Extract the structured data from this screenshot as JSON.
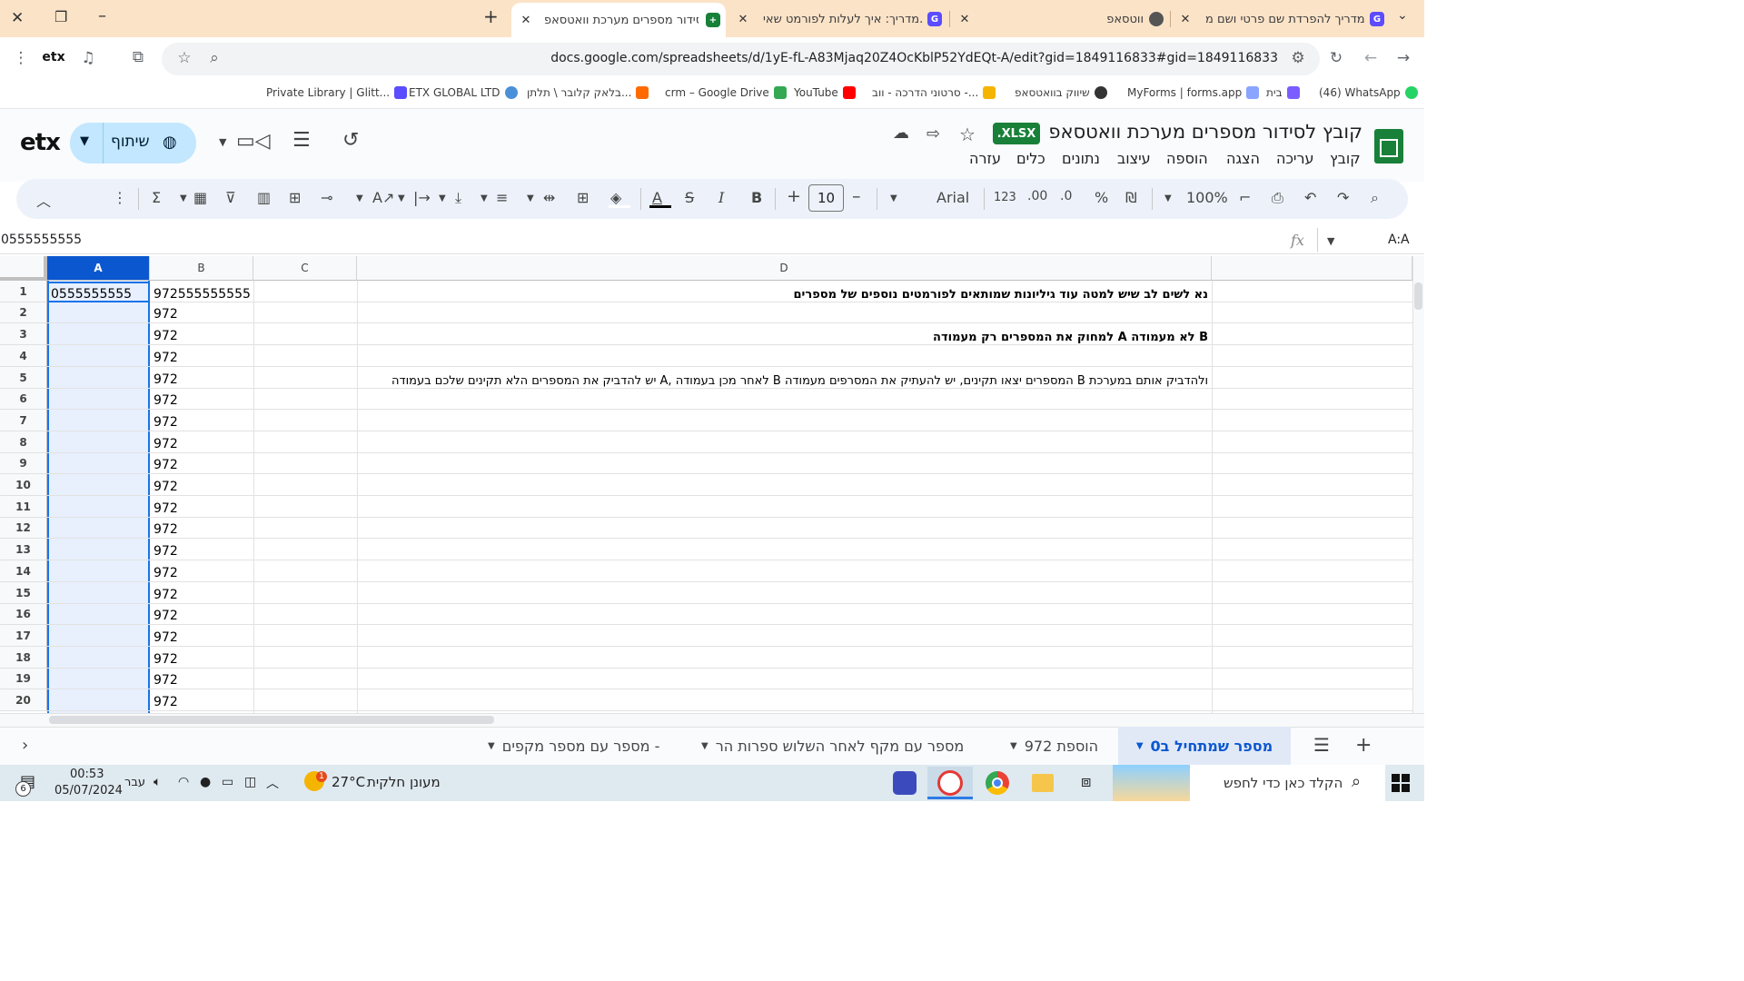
{
  "browser": {
    "tabs": [
      {
        "title": "מדריך להפרדת שם פרטי ושם מ...",
        "icon": "glitter-icon"
      },
      {
        "title": "ווטסאפ",
        "icon": "globe-icon"
      },
      {
        "title": "מדריך: איך לעלות לפורמט שאי...",
        "icon": "glitter-icon"
      },
      {
        "title": "קובץ לסידור מספרים מערכת וואטסאפ",
        "icon": "sheets-icon"
      }
    ],
    "url": "docs.google.com/spreadsheets/d/1yE-fL-A83Mjaq20Z4OcKblP52YdEQt-A/edit?gid=1849116833#gid=1849116833",
    "bookmarks": [
      {
        "label": "(46) WhatsApp",
        "color": "#25d366"
      },
      {
        "label": "בית",
        "color": "#7b5cff"
      },
      {
        "label": "MyForms | forms.app",
        "color": "#8aa4ff"
      },
      {
        "label": "שיווק בוואטסאפ",
        "color": "#333333"
      },
      {
        "label": "סרטוני הדרכה - ווב -...",
        "color": "#f4b400"
      },
      {
        "label": "YouTube",
        "color": "#ff0000"
      },
      {
        "label": "crm – Google Drive",
        "color": "#34a853"
      },
      {
        "label": "בלאק קלובר \\ תלתן...",
        "color": "#ff6a00"
      },
      {
        "label": "ETX GLOBAL LTD",
        "color": "#4a90d9"
      },
      {
        "label": "Private Library | Glitt...",
        "color": "#5b4cff"
      }
    ]
  },
  "doc": {
    "title": "קובץ לסידור מספרים מערכת וואטסאפ",
    "badge": ".XLSX",
    "share_label": "שיתוף",
    "menus": [
      "קובץ",
      "עריכה",
      "הצגה",
      "הוספה",
      "עיצוב",
      "נתונים",
      "כלים",
      "עזרה"
    ],
    "zoom": "100%",
    "font": "Arial",
    "font_size": "10",
    "currency": "₪",
    "percent": "%",
    "dec_less": ".0",
    "dec_more": ".00",
    "number_format": "123"
  },
  "formula_bar": {
    "name_box": "A:A",
    "fx": "fx",
    "content": "0555555555"
  },
  "grid": {
    "columns": [
      "A",
      "B",
      "C",
      "D"
    ],
    "rows": [
      "1",
      "2",
      "3",
      "4",
      "5",
      "6",
      "7",
      "8",
      "9",
      "10",
      "11",
      "12",
      "13",
      "14",
      "15",
      "16",
      "17",
      "18",
      "19",
      "20"
    ],
    "A1": "0555555555",
    "B1": "972555555555",
    "B_rest": "972",
    "D1": "נא לשים לב שיש למטה עוד גיליונות שמותאים לפורמטים נוספים של מספרים",
    "D3": "למחוק את המספרים רק מעמודה A לא מעמודה B",
    "D5": "יש להדביק את המספרים הלא תקינים שלכם בעמודה A, לאחר מכן בעמודה B המספרים יצאו תקינים, יש להעתיק את המסרפים מעמודה B ולהדביק אותם במערכת"
  },
  "sheets": [
    {
      "label": "מספר שמתחיל ב0",
      "active": true
    },
    {
      "label": "הוספת 972",
      "active": false
    },
    {
      "label": "מספר עם מקף לאחר השלוש ספרות הר",
      "active": false
    },
    {
      "label": "מספר עם מספר מקפים -",
      "active": false
    }
  ],
  "taskbar": {
    "search_placeholder": "הקלד כאן כדי לחפש",
    "weather_temp": "27°C",
    "weather_text": "מעונן חלקית",
    "lang": "עבר",
    "time": "00:53",
    "date": "05/07/2024",
    "notif_count": "6",
    "weather_badge": "1"
  },
  "colors": {
    "tab_strip": "#fbe3c8",
    "selected": "#1a73e8",
    "selected_fill": "#e8f0fe",
    "sheets_green": "#188038",
    "xlsx_badge": "#188038",
    "share_bg": "#c2e7ff"
  }
}
